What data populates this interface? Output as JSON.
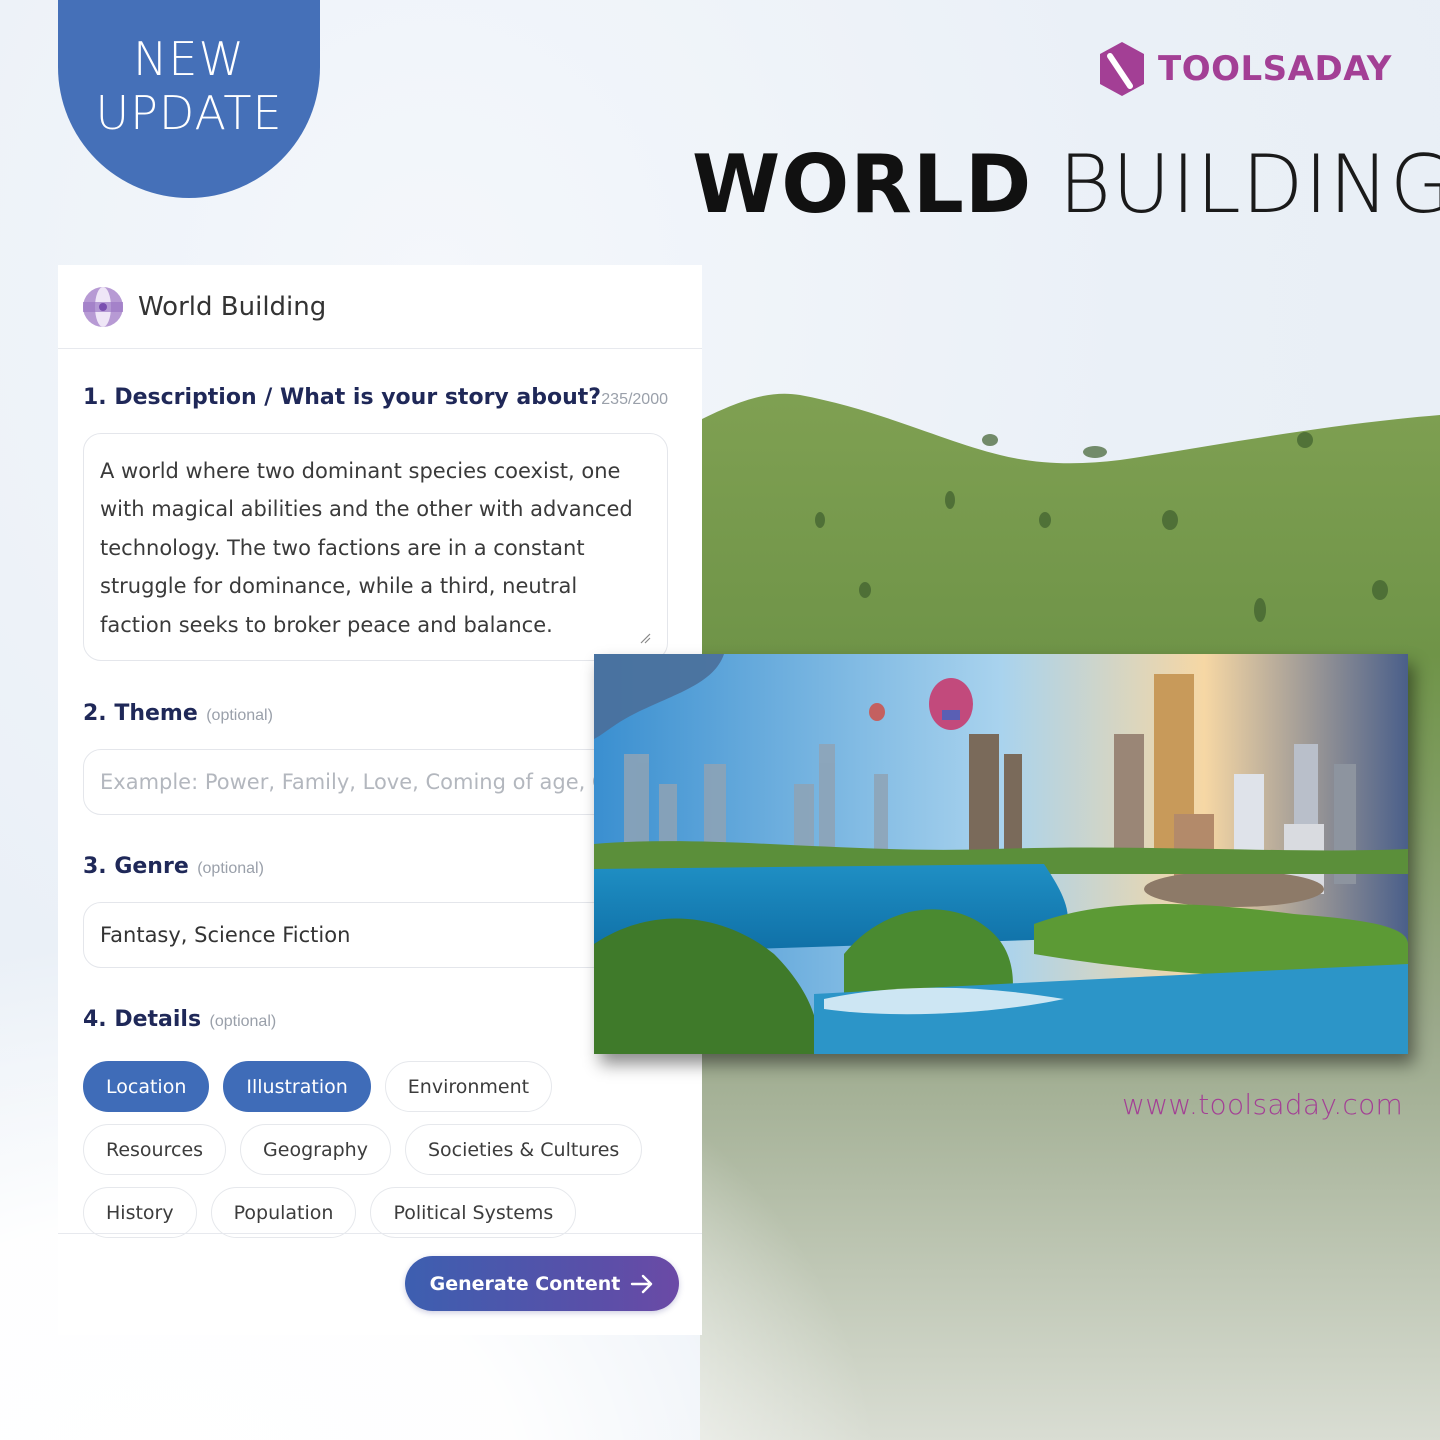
{
  "badge": {
    "line1": "NEW",
    "line2": "UPDATE"
  },
  "brand": {
    "name": "TOOLSADAY",
    "color": "#a33f95",
    "url": "www.toolsaday.com"
  },
  "hero": {
    "title_bold": "WORLD",
    "title_light": "BUILDING"
  },
  "card": {
    "title": "World Building",
    "icon": "globe-icon",
    "fields": {
      "description": {
        "label": "1. Description / What is your story about?",
        "counter": "235/2000",
        "value": "A world where two dominant species coexist, one with magical abilities and the other with advanced technology. The two factions are in a constant struggle for dominance, while a third, neutral faction seeks to broker peace and balance."
      },
      "theme": {
        "label": "2. Theme",
        "optional": "(optional)",
        "placeholder": "Example: Power, Family, Love, Coming of age, Good vs Evil",
        "value": ""
      },
      "genre": {
        "label": "3. Genre",
        "optional": "(optional)",
        "value": "Fantasy, Science Fiction"
      },
      "details": {
        "label": "4. Details",
        "optional": "(optional)",
        "chips": [
          {
            "label": "Location",
            "selected": true
          },
          {
            "label": "Illustration",
            "selected": true
          },
          {
            "label": "Environment",
            "selected": false
          },
          {
            "label": "Resources",
            "selected": false
          },
          {
            "label": "Geography",
            "selected": false
          },
          {
            "label": "Societies & Cultures",
            "selected": false
          },
          {
            "label": "History",
            "selected": false
          },
          {
            "label": "Population",
            "selected": false
          },
          {
            "label": "Political Systems",
            "selected": false
          }
        ]
      }
    },
    "generate_label": "Generate Content"
  },
  "colors": {
    "badge": "#4570b8",
    "chip_active": "#3f6cb8",
    "label": "#1f2858",
    "button_start": "#3d5fb0",
    "button_end": "#6b4aa6"
  },
  "artwork": {
    "description": "fantasy city with lake, waterfalls and hot air balloons"
  }
}
